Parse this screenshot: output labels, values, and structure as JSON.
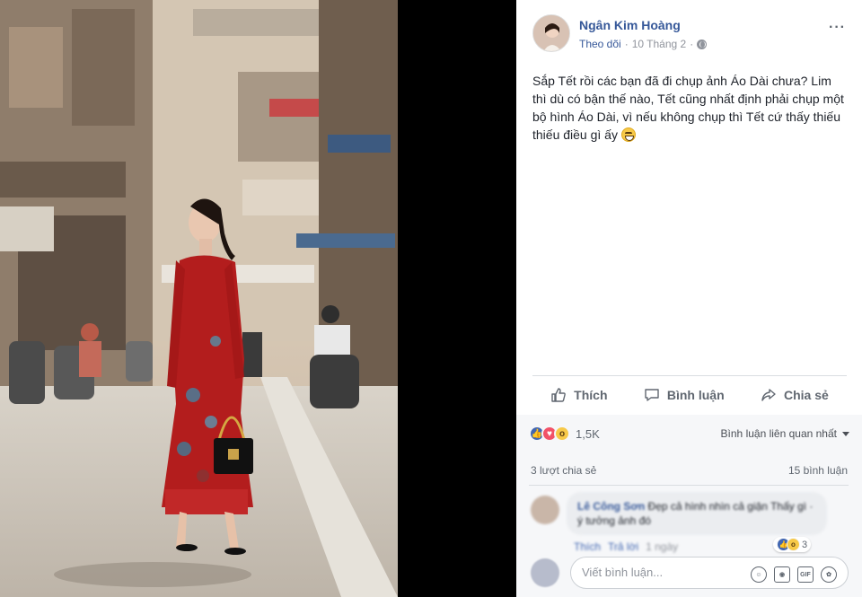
{
  "post": {
    "author": "Ngân Kim Hoàng",
    "follow_label": "Theo dõi",
    "separator": "·",
    "date": "10 Tháng 2",
    "more": "···",
    "text": "Sắp Tết rồi các bạn đã đi chụp ảnh Áo Dài chưa? Lim thì dù có bận thế nào, Tết cũng nhất định phải chụp một bộ hình Áo Dài, vì nếu không chụp thì Tết cứ thấy thiếu thiếu điều gì ấy"
  },
  "actions": {
    "like": "Thích",
    "comment": "Bình luận",
    "share": "Chia sẻ"
  },
  "stats": {
    "reactions_count": "1,5K",
    "sort_label": "Bình luận liên quan nhất",
    "shares": "3 lượt chia sẻ",
    "comments": "15 bình luận"
  },
  "comment": {
    "name": "Lê Công Sơn",
    "text": "Đẹp cả hình nhìn cả giận Thấy gì · ý tưởng ảnh đó",
    "like": "Thích",
    "reply": "Trả lời",
    "time": "1 ngày",
    "react_count": "3"
  },
  "composer": {
    "placeholder": "Viết bình luận...",
    "gif": "GIF"
  },
  "colors": {
    "link": "#365899",
    "dress": "#b31d1d",
    "like_blue": "#4267b2"
  }
}
